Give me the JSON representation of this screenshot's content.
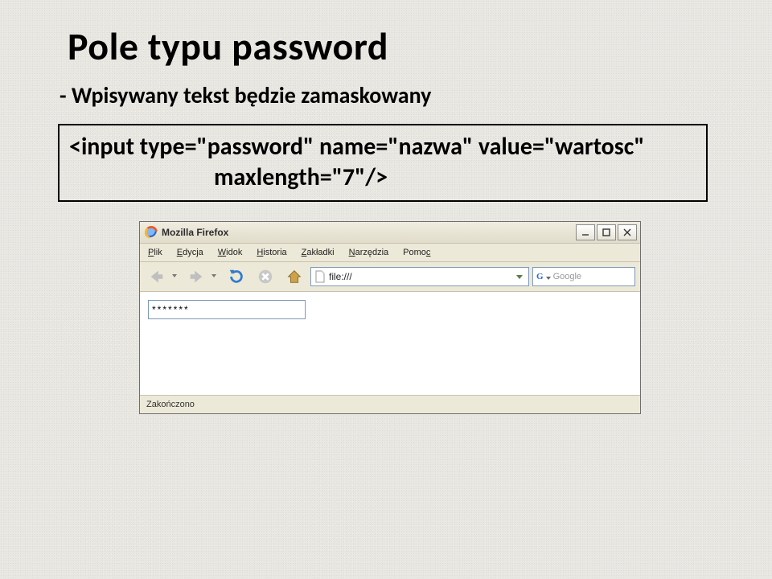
{
  "slide": {
    "title": "Pole typu password",
    "bullet": "- Wpisywany tekst będzie zamaskowany",
    "code_line1": "<input type=\"password\" name=\"nazwa\" value=\"wartosc\"",
    "code_line2": "maxlength=\"7\"/>"
  },
  "browser": {
    "app_title": "Mozilla Firefox",
    "menu": {
      "plik": {
        "pre": "",
        "ul": "P",
        "post": "lik"
      },
      "edycja": {
        "pre": "",
        "ul": "E",
        "post": "dycja"
      },
      "widok": {
        "pre": "",
        "ul": "W",
        "post": "idok"
      },
      "historia": {
        "pre": "",
        "ul": "H",
        "post": "istoria"
      },
      "zakladki": {
        "pre": "",
        "ul": "Z",
        "post": "akładki"
      },
      "narzedzia": {
        "pre": "",
        "ul": "N",
        "post": "arzędzia"
      },
      "pomoc": {
        "pre": "Pomo",
        "ul": "c",
        "post": ""
      }
    },
    "url_text": "file:///",
    "search_engine_letter": "G",
    "search_placeholder": "Google",
    "password_value": "*******",
    "status_text": "Zakończono"
  }
}
